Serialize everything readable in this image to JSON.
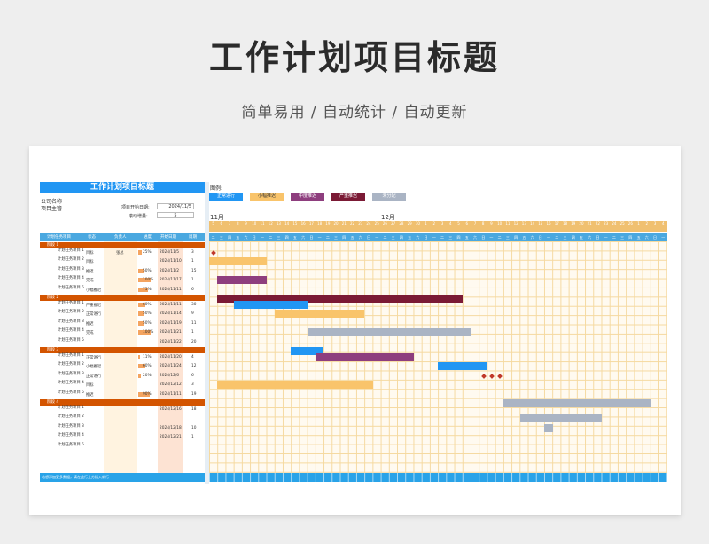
{
  "page": {
    "title": "工作计划项目标题",
    "subtitle": "简单易用 / 自动统计 / 自动更新"
  },
  "sheet": {
    "title": "工作计划项目标题",
    "company_label": "公司名称",
    "supervisor_label": "项目主管",
    "start_label": "项目开始日期:",
    "start_value": "2024/11/5",
    "scroll_label": "滚动增量:",
    "scroll_value": "5",
    "columns": [
      "计划任务项目",
      "状态",
      "负责人",
      "进度",
      "开始日期",
      "周期"
    ],
    "groups": [
      {
        "name": "阶段 1",
        "rows": [
          {
            "task": "计划任务项目 1",
            "status": "目标",
            "owner": "张总",
            "progress": "25%",
            "pval": 0.25,
            "start": "2024/11/5",
            "days": "3"
          },
          {
            "task": "计划任务项目 2",
            "status": "目标",
            "owner": "",
            "progress": "",
            "pval": 0,
            "start": "2024/11/10",
            "days": "1"
          },
          {
            "task": "计划任务项目 3",
            "status": "推迟",
            "owner": "",
            "progress": "50%",
            "pval": 0.5,
            "start": "2024/11/2",
            "days": "15"
          },
          {
            "task": "计划任务项目 4",
            "status": "完成",
            "owner": "",
            "progress": "100%",
            "pval": 1,
            "start": "2024/11/17",
            "days": "1"
          },
          {
            "task": "计划任务项目 5",
            "status": "小幅推迟",
            "owner": "",
            "progress": "75%",
            "pval": 0.75,
            "start": "2024/11/11",
            "days": "6"
          }
        ]
      },
      {
        "name": "阶段 2",
        "rows": [
          {
            "task": "计划任务项目 1",
            "status": "严重推迟",
            "owner": "",
            "progress": "60%",
            "pval": 0.6,
            "start": "2024/11/11",
            "days": "30"
          },
          {
            "task": "计划任务项目 2",
            "status": "正常进行",
            "owner": "",
            "progress": "50%",
            "pval": 0.5,
            "start": "2024/11/14",
            "days": "9"
          },
          {
            "task": "计划任务项目 3",
            "status": "推迟",
            "owner": "",
            "progress": "50%",
            "pval": 0.5,
            "start": "2024/11/19",
            "days": "11"
          },
          {
            "task": "计划任务项目 4",
            "status": "完成",
            "owner": "",
            "progress": "100%",
            "pval": 1,
            "start": "2024/11/21",
            "days": "1"
          },
          {
            "task": "计划任务项目 5",
            "status": "",
            "owner": "",
            "progress": "",
            "pval": 0,
            "start": "2024/11/22",
            "days": "20"
          }
        ]
      },
      {
        "name": "阶段 3",
        "rows": [
          {
            "task": "计划任务项目 1",
            "status": "正常进行",
            "owner": "",
            "progress": "11%",
            "pval": 0.11,
            "start": "2024/11/20",
            "days": "4"
          },
          {
            "task": "计划任务项目 2",
            "status": "小幅推迟",
            "owner": "",
            "progress": "60%",
            "pval": 0.6,
            "start": "2024/11/24",
            "days": "12"
          },
          {
            "task": "计划任务项目 3",
            "status": "正常进行",
            "owner": "",
            "progress": "20%",
            "pval": 0.2,
            "start": "2024/12/6",
            "days": "6"
          },
          {
            "task": "计划任务项目 4",
            "status": "目标",
            "owner": "",
            "progress": "",
            "pval": 0,
            "start": "2024/12/12",
            "days": "3"
          },
          {
            "task": "计划任务项目 5",
            "status": "推迟",
            "owner": "",
            "progress": "90%",
            "pval": 0.9,
            "start": "2024/11/11",
            "days": "19"
          }
        ]
      },
      {
        "name": "阶段 4",
        "rows": [
          {
            "task": "计划任务项目 1",
            "status": "",
            "owner": "",
            "progress": "",
            "pval": 0,
            "start": "2024/12/16",
            "days": "18"
          },
          {
            "task": "计划任务项目 2",
            "status": "",
            "owner": "",
            "progress": "",
            "pval": 0,
            "start": "",
            "days": ""
          },
          {
            "task": "计划任务项目 3",
            "status": "",
            "owner": "",
            "progress": "",
            "pval": 0,
            "start": "2024/12/18",
            "days": "10"
          },
          {
            "task": "计划任务项目 4",
            "status": "",
            "owner": "",
            "progress": "",
            "pval": 0,
            "start": "2024/12/21",
            "days": "1"
          },
          {
            "task": "计划任务项目 5",
            "status": "",
            "owner": "",
            "progress": "",
            "pval": 0,
            "start": "",
            "days": ""
          }
        ]
      }
    ],
    "footer_note": "若想添加更多数据，请在此行上方插入新行"
  },
  "gantt": {
    "legend_label": "图例:",
    "legend": [
      {
        "label": "正常进行",
        "color": "#2196f3"
      },
      {
        "label": "小幅推迟",
        "color": "#f9c46b"
      },
      {
        "label": "中度推迟",
        "color": "#8e3e7e"
      },
      {
        "label": "严重推迟",
        "color": "#7b1a35"
      },
      {
        "label": "未分配",
        "color": "#aab4c4"
      }
    ],
    "months": [
      "11月",
      "12月"
    ],
    "day_numbers": [
      "5",
      "6",
      "7",
      "8",
      "9",
      "10",
      "11",
      "12",
      "13",
      "14",
      "15",
      "16",
      "17",
      "18",
      "19",
      "20",
      "21",
      "22",
      "23",
      "24",
      "25",
      "26",
      "27",
      "28",
      "29",
      "30",
      "1",
      "2",
      "3",
      "4",
      "5",
      "6",
      "7",
      "8",
      "9",
      "10",
      "11",
      "12",
      "13",
      "14",
      "15",
      "16",
      "17",
      "18",
      "19",
      "20",
      "21",
      "22",
      "23",
      "24",
      "25",
      "26",
      "1",
      "2",
      "3",
      "4"
    ],
    "weekdays": [
      "二",
      "三",
      "四",
      "五",
      "六",
      "日",
      "一",
      "二",
      "三",
      "四",
      "五",
      "六",
      "日",
      "一",
      "二",
      "三",
      "四",
      "五",
      "六",
      "日",
      "一",
      "二",
      "三",
      "四",
      "五",
      "六",
      "日",
      "一",
      "二",
      "三",
      "四",
      "五",
      "六",
      "日",
      "一",
      "二",
      "三",
      "四",
      "五",
      "六",
      "日",
      "一",
      "二",
      "三",
      "四",
      "五",
      "六",
      "日",
      "一",
      "二",
      "三",
      "四",
      "五",
      "六",
      "日",
      "一"
    ],
    "bars": [
      {
        "row": 1,
        "start": 0,
        "len": 1,
        "type": "diamond"
      },
      {
        "row": 2,
        "start": 0,
        "len": 7,
        "color": "#f9c46b"
      },
      {
        "row": 4,
        "start": 1,
        "len": 6,
        "color": "#8e3e7e"
      },
      {
        "row": 6,
        "start": 1,
        "len": 30,
        "color": "#7b1a35"
      },
      {
        "row": 7,
        "start": 3,
        "len": 9,
        "color": "#2196f3"
      },
      {
        "row": 8,
        "start": 8,
        "len": 11,
        "color": "#f9c46b"
      },
      {
        "row": 10,
        "start": 12,
        "len": 20,
        "color": "#aab4c4"
      },
      {
        "row": 12,
        "start": 10,
        "len": 4,
        "color": "#2196f3"
      },
      {
        "row": 13,
        "start": 13,
        "len": 12,
        "color": "#8e3e7e"
      },
      {
        "row": 14,
        "start": 28,
        "len": 6,
        "color": "#2196f3"
      },
      {
        "row": 15,
        "start": 33,
        "len": 3,
        "type": "diamond"
      },
      {
        "row": 16,
        "start": 1,
        "len": 19,
        "color": "#f9c46b"
      },
      {
        "row": 18,
        "start": 36,
        "len": 18,
        "color": "#aab4c4"
      },
      {
        "row": 20,
        "start": 38,
        "len": 10,
        "color": "#aab4c4"
      },
      {
        "row": 21,
        "start": 41,
        "len": 1,
        "color": "#aab4c4"
      }
    ]
  }
}
